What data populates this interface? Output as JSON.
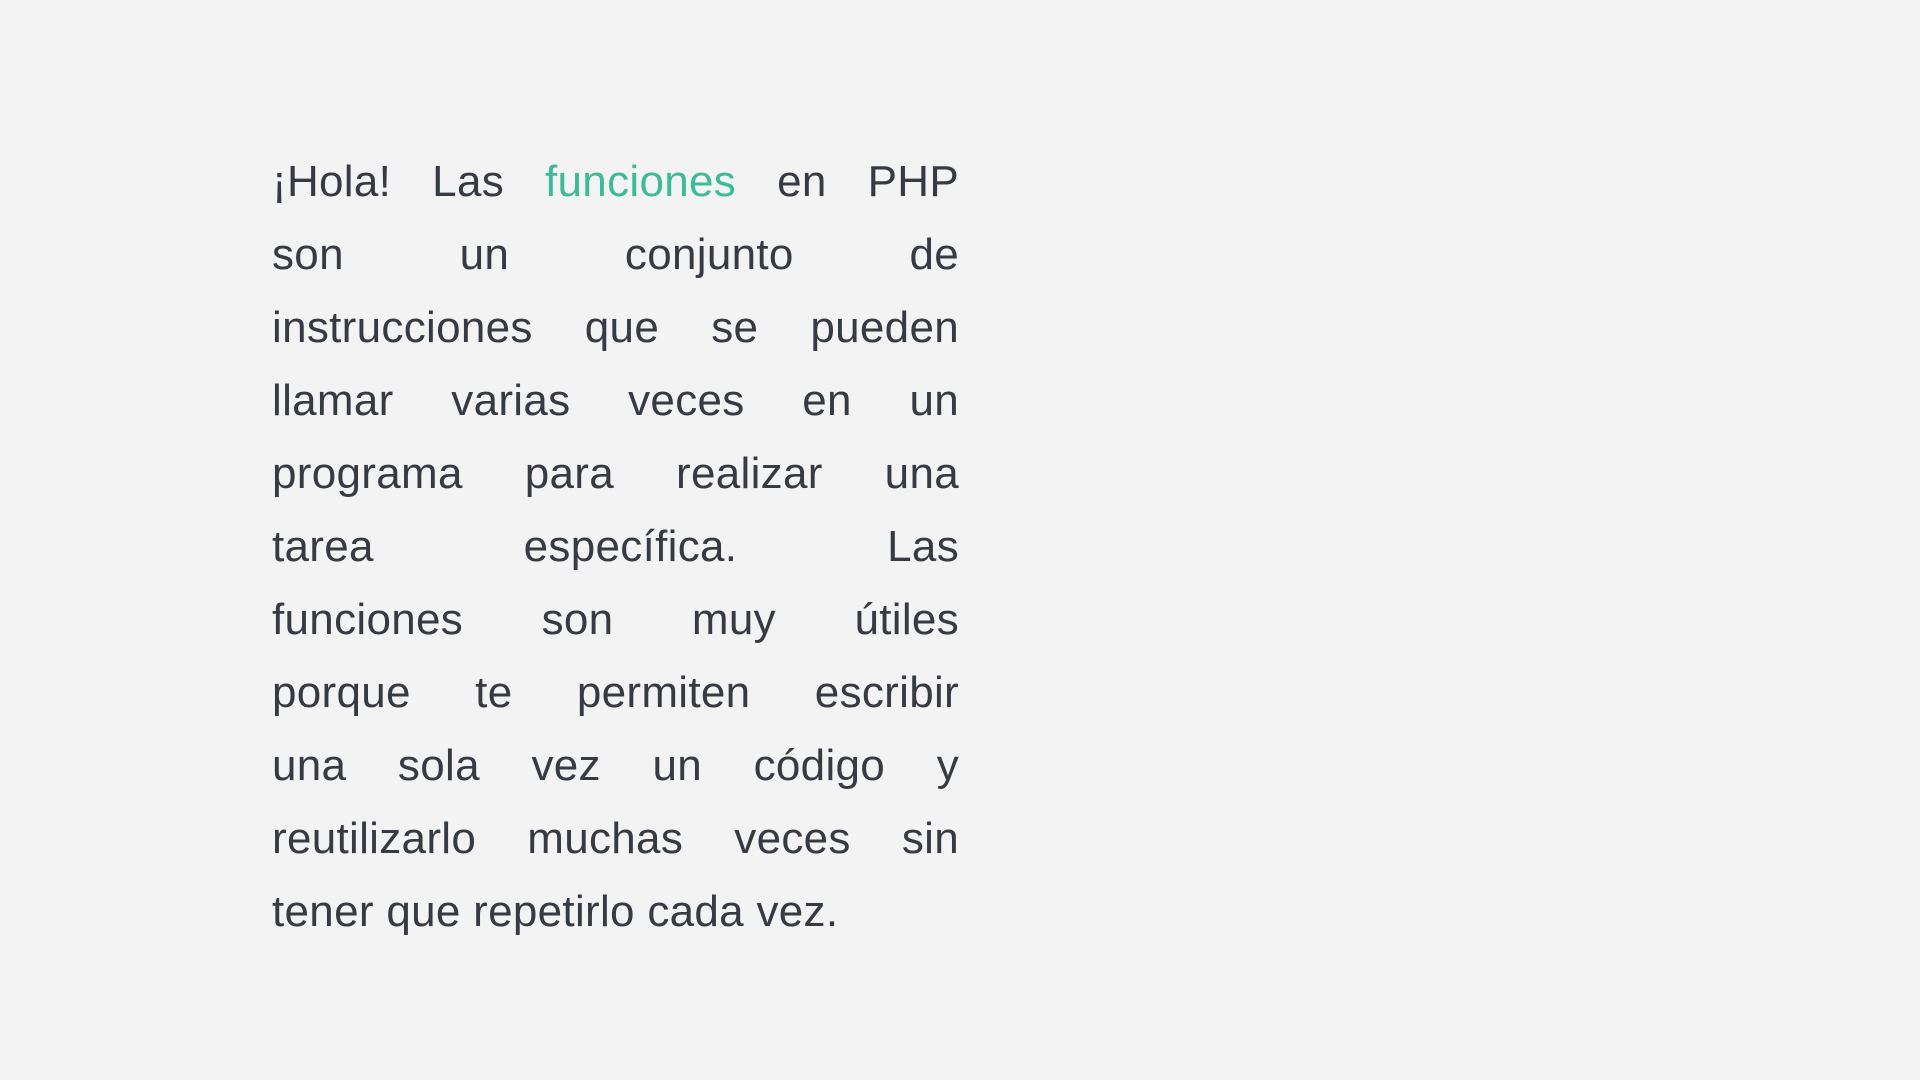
{
  "paragraph": {
    "first_line": {
      "before": "¡Hola! Las ",
      "highlight": "funciones",
      "after": " en PHP"
    },
    "lines": [
      "son un conjunto de",
      "instrucciones que se pueden",
      "llamar varias veces en un",
      "programa para realizar una",
      "tarea específica. Las",
      "funciones son muy útiles",
      "porque te permiten escribir",
      "una sola vez un código y",
      "reutilizarlo muchas veces sin",
      "tener que repetirlo cada vez."
    ]
  },
  "colors": {
    "text": "#363a43",
    "highlight": "#3dba98",
    "background": "#f3f3f3"
  }
}
